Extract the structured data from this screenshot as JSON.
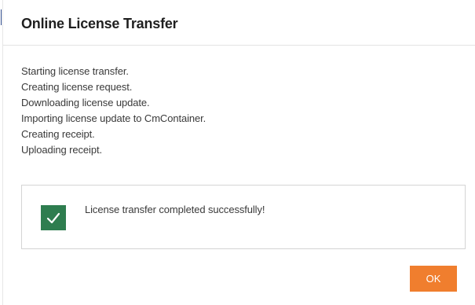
{
  "dialog": {
    "title": "Online License Transfer"
  },
  "log": {
    "lines": [
      "Starting license transfer.",
      "Creating license request.",
      "Downloading license update.",
      "Importing license update to CmContainer.",
      "Creating receipt.",
      "Uploading receipt."
    ]
  },
  "result": {
    "icon": "check-icon",
    "message": "License transfer completed successfully!",
    "icon_color": "#2e7d4f"
  },
  "actions": {
    "ok_label": "OK",
    "ok_color": "#f07e2e"
  }
}
